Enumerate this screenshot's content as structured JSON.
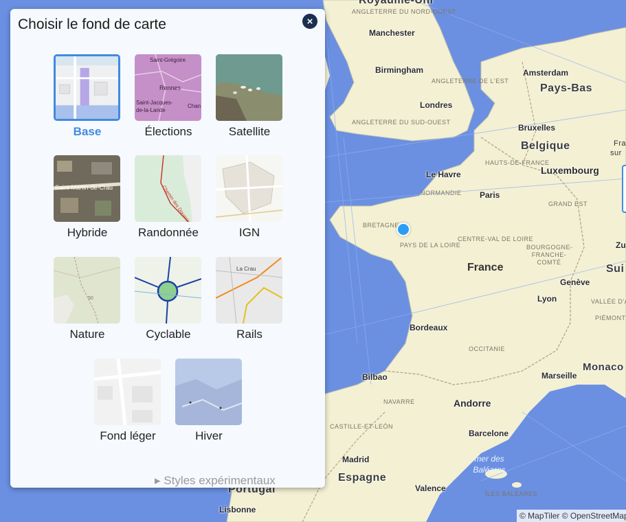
{
  "panel": {
    "title": "Choisir le fond de carte",
    "close_icon": "×",
    "tiles": [
      {
        "label": "Base",
        "selected": true
      },
      {
        "label": "Élections"
      },
      {
        "label": "Satellite"
      },
      {
        "label": "Hybride"
      },
      {
        "label": "Randonnée"
      },
      {
        "label": "IGN"
      },
      {
        "label": "Nature"
      },
      {
        "label": "Cyclable"
      },
      {
        "label": "Rails"
      },
      {
        "label": "Fond léger"
      },
      {
        "label": "Hiver"
      }
    ],
    "experimental": "▸ Styles expérimentaux"
  },
  "thumbs": {
    "elections_1": "Saint-Grégoire",
    "elections_2": "Rennes",
    "elections_3": "Saint-Jacques-",
    "elections_4": "de-la-Lande",
    "elections_5": "Chan",
    "hybrid_1": "Saint-Martin-de-Crau",
    "rando_1": "Chemin des Douaniers",
    "nature_1": "50",
    "rails_1": "La Crau"
  },
  "map": {
    "cities": [
      "Manchester",
      "Birmingham",
      "Londres",
      "Amsterdam",
      "Bruxelles",
      "Le Havre",
      "Paris",
      "Luxembourg",
      "Bordeaux",
      "Lyon",
      "Genève",
      "Bilbao",
      "Marseille",
      "Madrid",
      "Barcelone",
      "Valence",
      "Lisbonne",
      "Monaco",
      "Zu"
    ],
    "countries": [
      "Royaume-Uni",
      "Pays-Bas",
      "Belgique",
      "France",
      "Espagne",
      "Portugal",
      "Andorre",
      "Sui"
    ],
    "regions": [
      "ANGLETERRE DU NORD-OUEST",
      "ANGLETERRE DE L'EST",
      "ANGLETERRE DU SUD-OUEST",
      "NORMANDIE",
      "HAUTS-DE-FRANCE",
      "GRAND EST",
      "BRETAGNE",
      "PAYS DE LA LOIRE",
      "CENTRE-VAL DE LOIRE",
      "BOURGOGNE-FRANCHE-COMTÉ",
      "OCCITANIE",
      "NAVARRE",
      "CASTILLE-ET-LEÓN",
      "VALLÉE D'AOSTE",
      "PIÉMONT",
      "ÎLES BALÉARES",
      "Fra",
      "sur"
    ],
    "sea": "mer des Baléares",
    "attribution": "© MapTiler © OpenStreetMap"
  },
  "colors": {
    "sea": "#6b90e2",
    "land": "#f3f0d4",
    "accent": "#3f8ae0",
    "location_dot": "#2a9df4"
  }
}
